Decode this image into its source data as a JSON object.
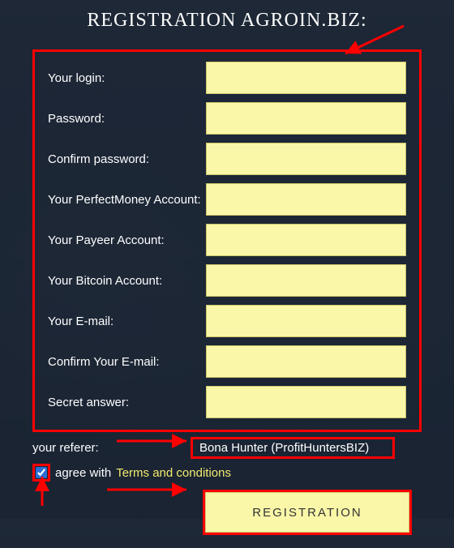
{
  "title": "REGISTRATION AGROIN.BIZ:",
  "fields": {
    "login": {
      "label": "Your login:",
      "value": ""
    },
    "password": {
      "label": "Password:",
      "value": ""
    },
    "confirm_password": {
      "label": "Confirm password:",
      "value": ""
    },
    "perfectmoney": {
      "label": "Your PerfectMoney Account:",
      "value": ""
    },
    "payeer": {
      "label": "Your Payeer Account:",
      "value": ""
    },
    "bitcoin": {
      "label": "Your Bitcoin Account:",
      "value": ""
    },
    "email": {
      "label": "Your E-mail:",
      "value": ""
    },
    "confirm_email": {
      "label": "Confirm Your E-mail:",
      "value": ""
    },
    "secret": {
      "label": "Secret answer:",
      "value": ""
    }
  },
  "referer": {
    "label": "your referer:",
    "value": "Bona Hunter (ProfitHuntersBIZ)"
  },
  "agree": {
    "prefix": "agree with",
    "link": "Terms and conditions",
    "checked": true
  },
  "submit": "REGISTRATION"
}
